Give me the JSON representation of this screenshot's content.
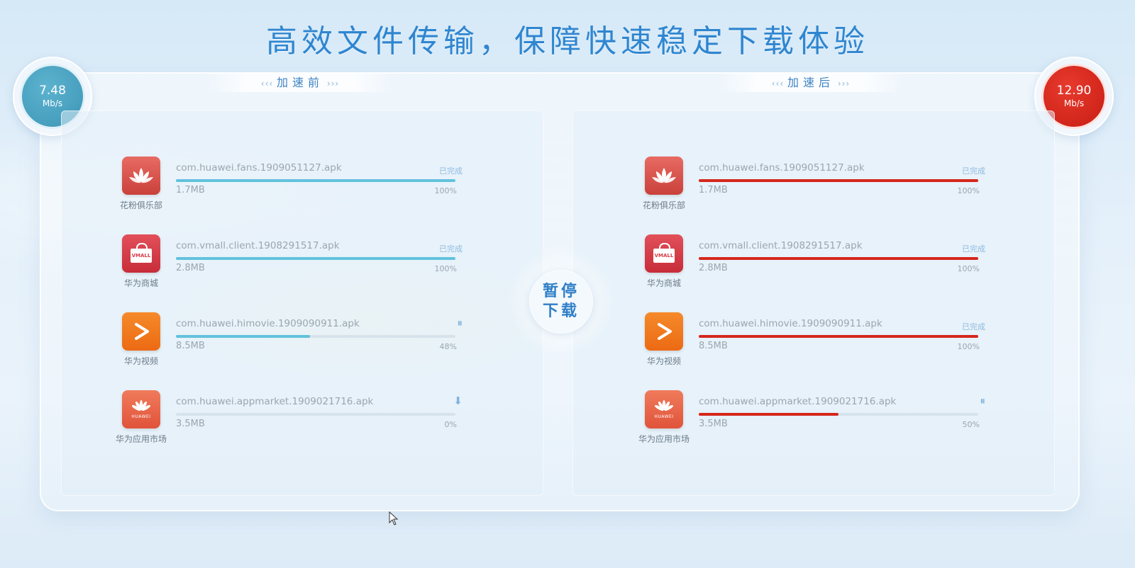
{
  "headline": "高效文件传输，保障快速稳定下载体验",
  "colors": {
    "accent_blue": "#62c2dc",
    "accent_red": "#d5271c",
    "title_blue": "#2f86d0"
  },
  "before": {
    "tab_label": "加速前",
    "speed": {
      "value": "7.48",
      "unit": "Mb/s"
    },
    "items": [
      {
        "icon": "lotus-icon",
        "label": "花粉俱乐部",
        "file": "com.huawei.fans.1909051127.apk",
        "size": "1.7MB",
        "status": "已完成",
        "percent_text": "100%",
        "progress": 1.0
      },
      {
        "icon": "vmall-bag-icon",
        "label": "华为商城",
        "file": "com.vmall.client.1908291517.apk",
        "size": "2.8MB",
        "status": "已完成",
        "percent_text": "100%",
        "progress": 1.0
      },
      {
        "icon": "play-icon",
        "label": "华为视频",
        "file": "com.huawei.himovie.1909090911.apk",
        "size": "8.5MB",
        "status": "⏸",
        "percent_text": "48%",
        "progress": 0.48
      },
      {
        "icon": "huawei-flower-icon",
        "label": "华为应用市场",
        "file": "com.huawei.appmarket.1909021716.apk",
        "size": "3.5MB",
        "status": "⬇",
        "percent_text": "0%",
        "progress": 0.0
      }
    ]
  },
  "after": {
    "tab_label": "加速后",
    "speed": {
      "value": "12.90",
      "unit": "Mb/s"
    },
    "items": [
      {
        "icon": "lotus-icon",
        "label": "花粉俱乐部",
        "file": "com.huawei.fans.1909051127.apk",
        "size": "1.7MB",
        "status": "已完成",
        "percent_text": "100%",
        "progress": 1.0
      },
      {
        "icon": "vmall-bag-icon",
        "label": "华为商城",
        "file": "com.vmall.client.1908291517.apk",
        "size": "2.8MB",
        "status": "已完成",
        "percent_text": "100%",
        "progress": 1.0
      },
      {
        "icon": "play-icon",
        "label": "华为视频",
        "file": "com.huawei.himovie.1909090911.apk",
        "size": "8.5MB",
        "status": "已完成",
        "percent_text": "100%",
        "progress": 1.0
      },
      {
        "icon": "huawei-flower-icon",
        "label": "华为应用市场",
        "file": "com.huawei.appmarket.1909021716.apk",
        "size": "3.5MB",
        "status": "⏸",
        "percent_text": "50%",
        "progress": 0.5
      }
    ]
  },
  "center_button": {
    "line1": "暂停",
    "line2": "下载"
  },
  "app_icon_text": {
    "vmall": "VMALL",
    "huawei": "HUAWEI"
  }
}
